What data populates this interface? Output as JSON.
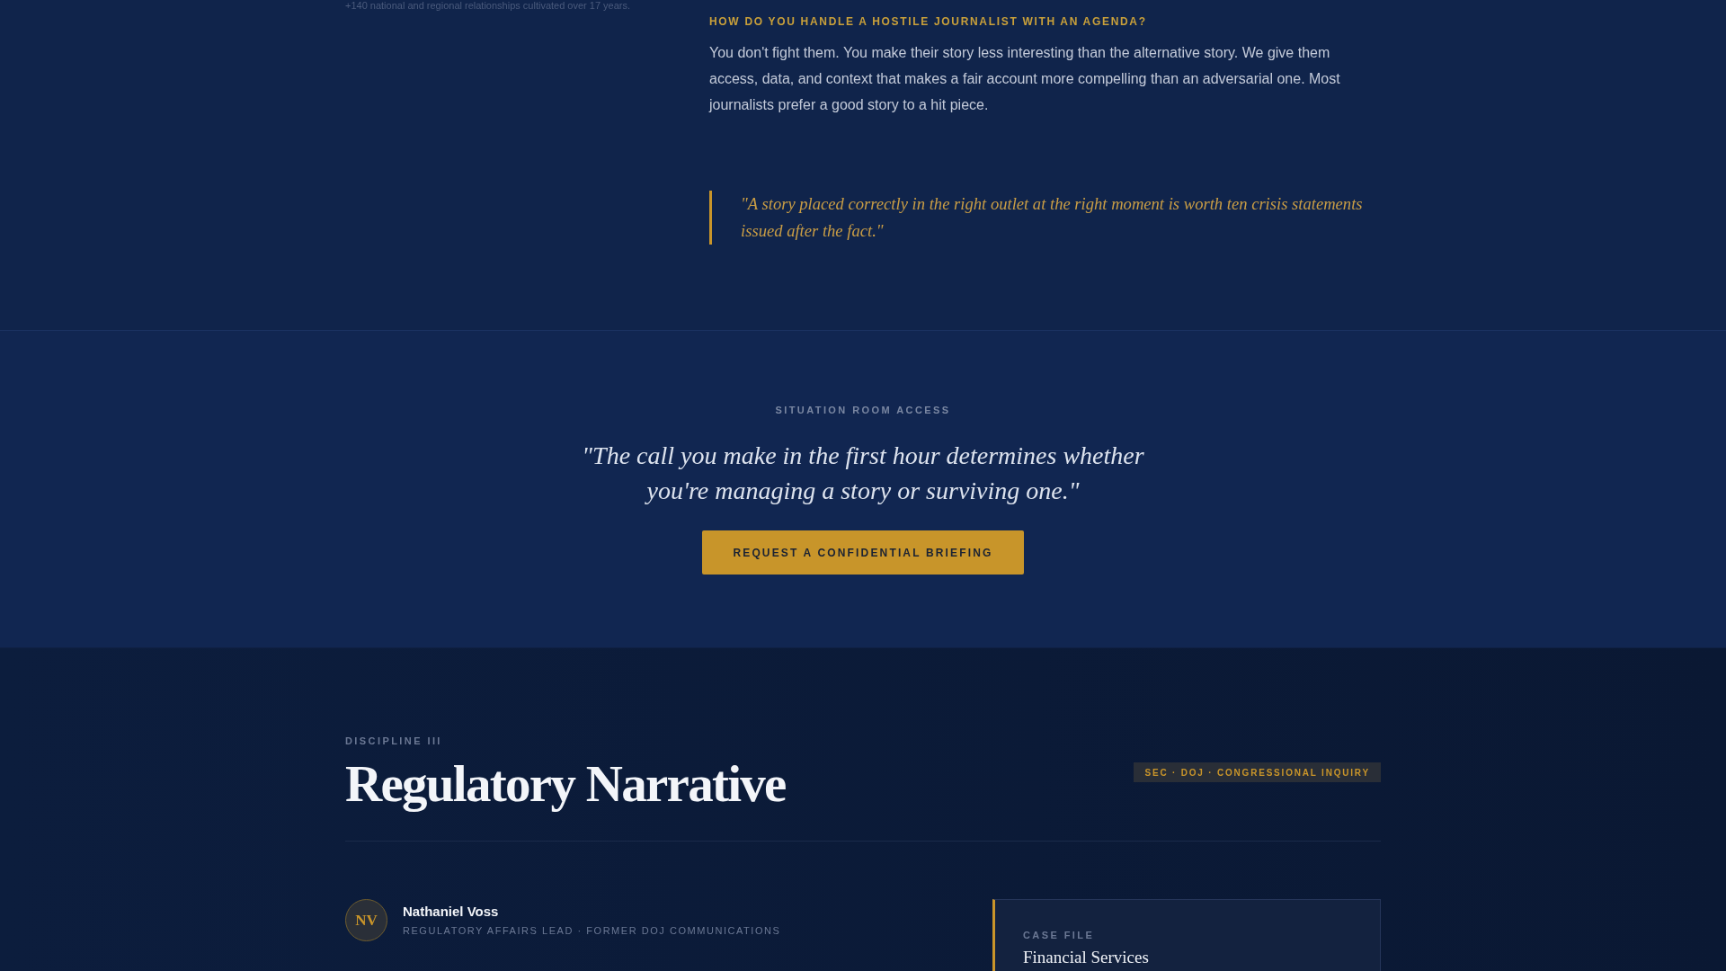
{
  "intro": {
    "footnote": "+140 national and regional relationships cultivated over 17 years."
  },
  "faq": [
    {
      "question": "HOW DO YOU HANDLE A HOSTILE JOURNALIST WITH AN AGENDA?",
      "answer": "You don't fight them. You make their story less interesting than the alternative story. We give them access, data, and context that makes a fair account more compelling than an adversarial one. Most journalists prefer a good story to a hit piece."
    }
  ],
  "pull_quote": "\"A story placed correctly in the right outlet at the right moment is worth ten crisis statements issued after the fact.\"",
  "cta_section": {
    "eyebrow": "SITUATION ROOM ACCESS",
    "quote": "\"The call you make in the first hour determines whether you're managing a story or surviving one.\"",
    "button": "REQUEST A CONFIDENTIAL BRIEFING"
  },
  "discipline": {
    "eyebrow": "DISCIPLINE III",
    "title": "Regulatory Narrative",
    "tag": "SEC · DOJ · CONGRESSIONAL INQUIRY",
    "lead": {
      "initials": "NV",
      "name": "Nathaniel Voss",
      "role": "REGULATORY AFFAIRS LEAD · FORMER DOJ COMMUNICATIONS"
    },
    "case_file": {
      "label": "CASE FILE",
      "title": "Financial Services"
    }
  }
}
